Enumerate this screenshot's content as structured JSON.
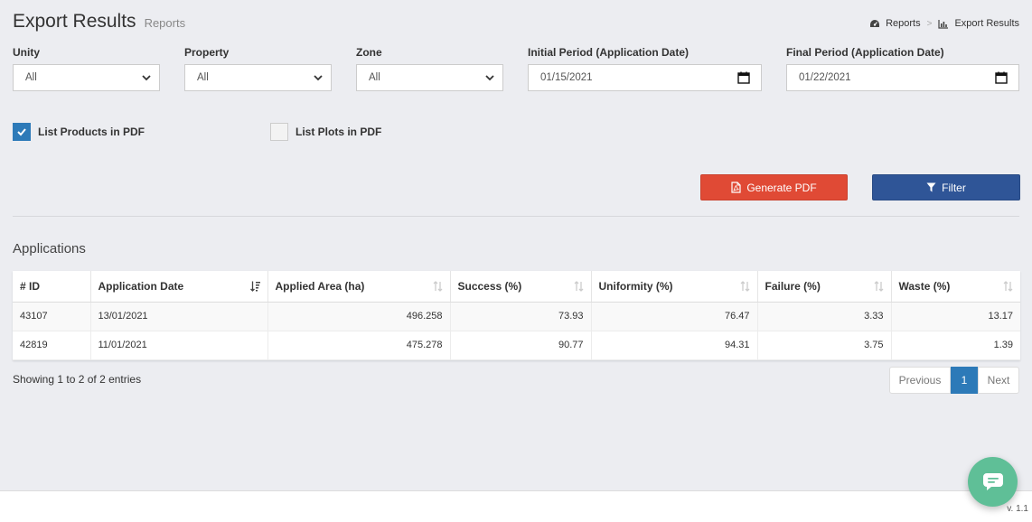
{
  "header": {
    "title": "Export Results",
    "subtitle": "Reports"
  },
  "breadcrumb": {
    "items": [
      {
        "label": "Reports",
        "icon": "dashboard-icon"
      },
      {
        "label": "Export Results",
        "icon": "bar-chart-icon"
      }
    ],
    "separator": ">"
  },
  "filters": {
    "unity": {
      "label": "Unity",
      "value": "All"
    },
    "property": {
      "label": "Property",
      "value": "All"
    },
    "zone": {
      "label": "Zone",
      "value": "All"
    },
    "initial_period": {
      "label": "Initial Period (Application Date)",
      "value": "01/15/2021"
    },
    "final_period": {
      "label": "Final Period (Application Date)",
      "value": "01/22/2021"
    }
  },
  "checkboxes": {
    "list_products": {
      "label": "List Products in PDF",
      "checked": true
    },
    "list_plots": {
      "label": "List Plots in PDF",
      "checked": false
    }
  },
  "actions": {
    "generate_pdf": "Generate PDF",
    "filter": "Filter"
  },
  "applications": {
    "title": "Applications",
    "columns": [
      "# ID",
      "Application Date",
      "Applied Area (ha)",
      "Success (%)",
      "Uniformity (%)",
      "Failure (%)",
      "Waste (%)"
    ],
    "rows": [
      [
        "43107",
        "13/01/2021",
        "496.258",
        "73.93",
        "76.47",
        "3.33",
        "13.17"
      ],
      [
        "42819",
        "11/01/2021",
        "475.278",
        "90.77",
        "94.31",
        "3.75",
        "1.39"
      ]
    ],
    "info": "Showing 1 to 2 of 2 entries",
    "pagination": {
      "previous": "Previous",
      "current": "1",
      "next": "Next"
    }
  },
  "footer": {
    "version": "v. 1.1"
  },
  "colors": {
    "primary": "#2d7ab8",
    "danger": "#e04a35",
    "filter": "#2f5597",
    "chat": "#5fbf97"
  }
}
